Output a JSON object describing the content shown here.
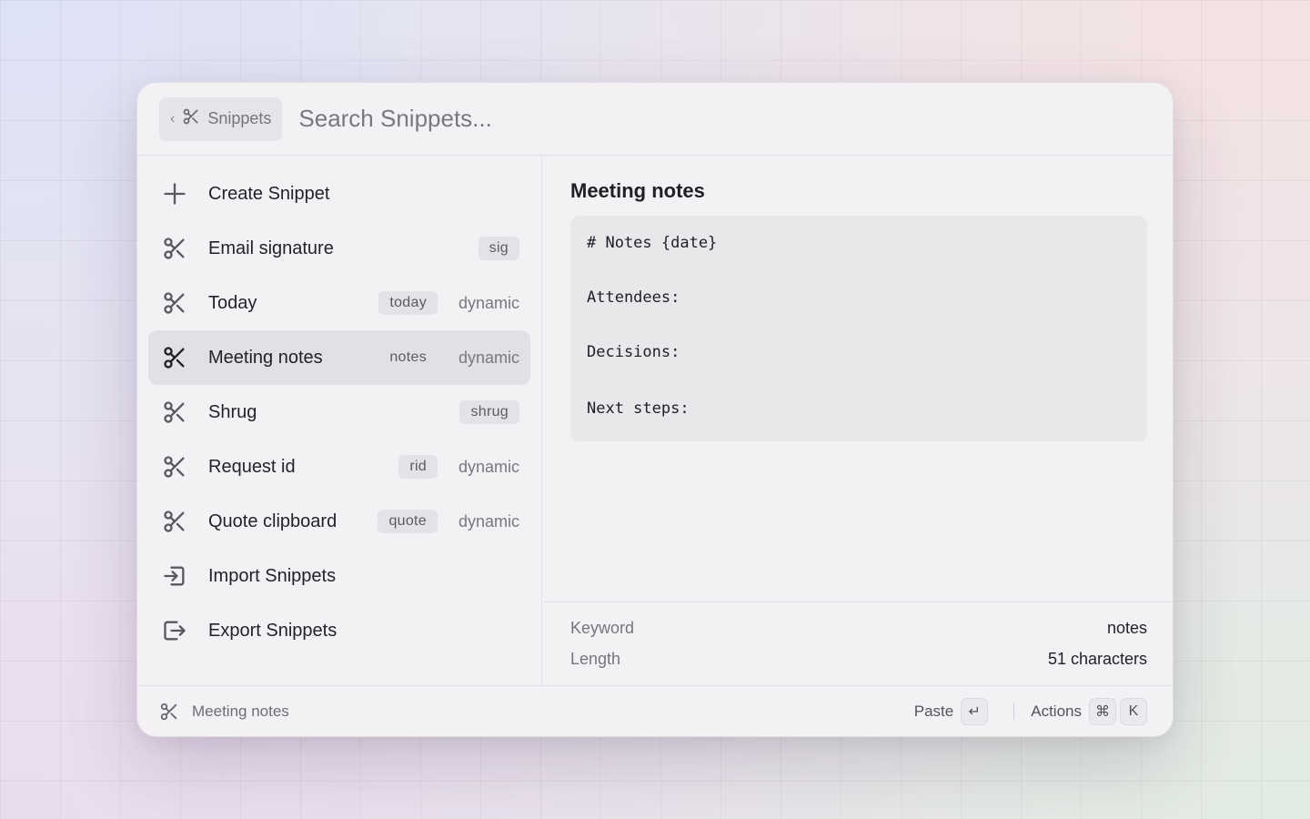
{
  "header": {
    "back_label": "Snippets",
    "search_placeholder": "Search Snippets..."
  },
  "items": [
    {
      "label": "Create Snippet",
      "icon": "plus-icon",
      "tag": "",
      "meta": ""
    },
    {
      "label": "Email signature",
      "icon": "scissors-icon",
      "tag": "sig",
      "meta": ""
    },
    {
      "label": "Today",
      "icon": "scissors-icon",
      "tag": "today",
      "meta": "dynamic"
    },
    {
      "label": "Meeting notes",
      "icon": "scissors-icon",
      "tag": "notes",
      "meta": "dynamic",
      "selected": true
    },
    {
      "label": "Shrug",
      "icon": "scissors-icon",
      "tag": "shrug",
      "meta": ""
    },
    {
      "label": "Request id",
      "icon": "scissors-icon",
      "tag": "rid",
      "meta": "dynamic"
    },
    {
      "label": "Quote clipboard",
      "icon": "scissors-icon",
      "tag": "quote",
      "meta": "dynamic"
    },
    {
      "label": "Import Snippets",
      "icon": "import-icon",
      "tag": "",
      "meta": ""
    },
    {
      "label": "Export Snippets",
      "icon": "export-icon",
      "tag": "",
      "meta": ""
    }
  ],
  "detail": {
    "title": "Meeting notes",
    "content_lines": [
      "# Notes {date}",
      "Attendees:",
      "Decisions:",
      "Next steps:"
    ],
    "keyword_label": "Keyword",
    "keyword_value": "notes",
    "length_label": "Length",
    "length_value": "51 characters"
  },
  "footer": {
    "title": "Meeting notes",
    "paste_label": "Paste",
    "paste_key": "↵",
    "actions_label": "Actions",
    "actions_key_1": "⌘",
    "actions_key_2": "K"
  }
}
